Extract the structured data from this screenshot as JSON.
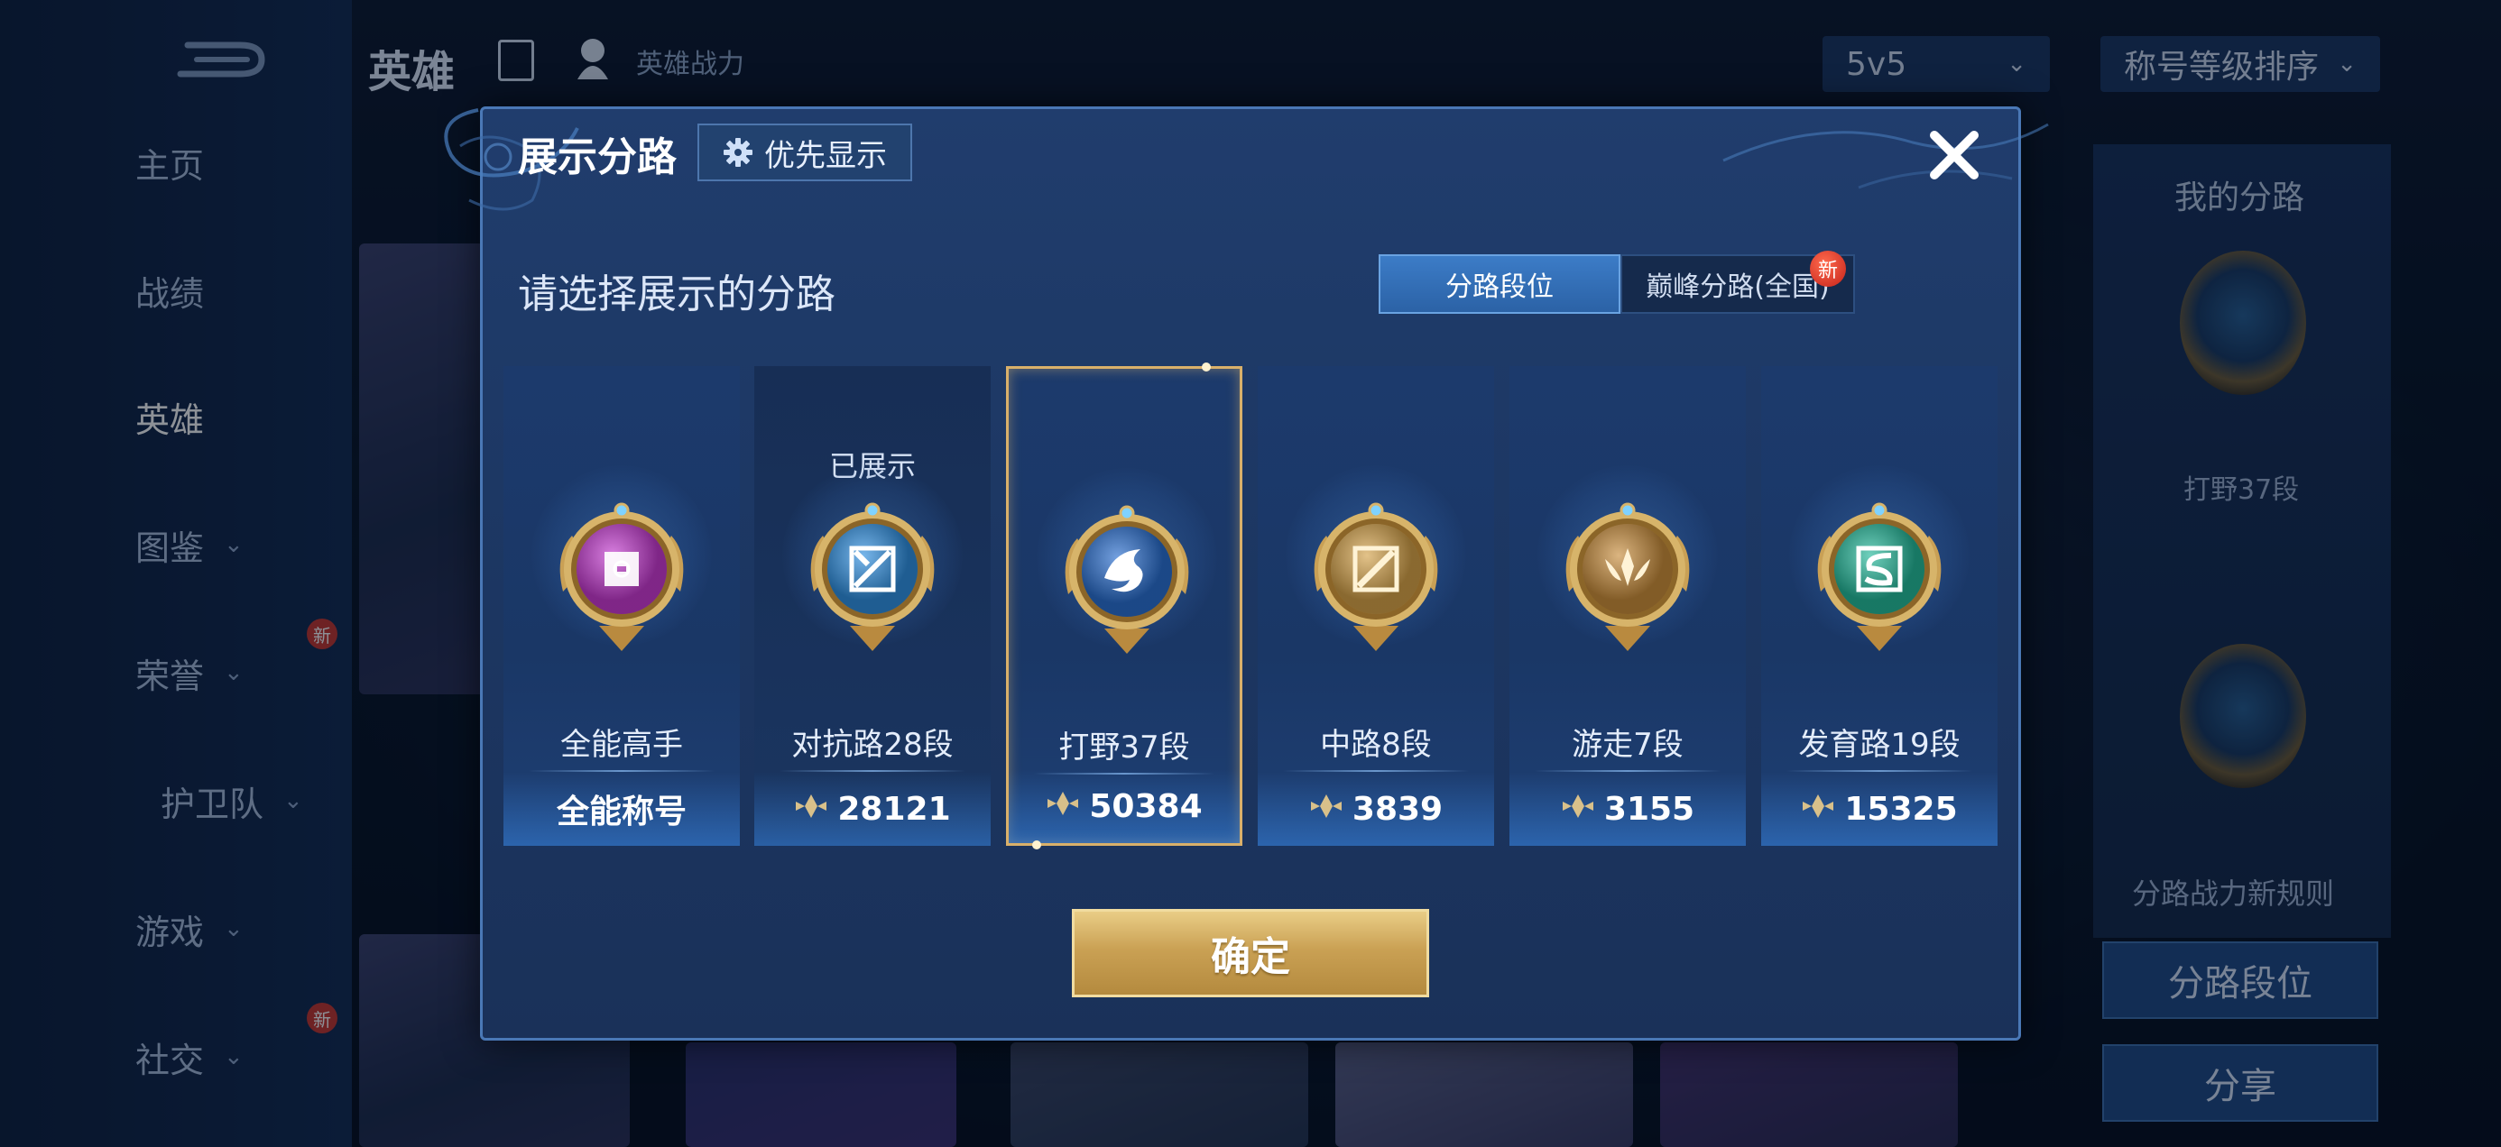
{
  "background": {
    "sidebar_items": [
      {
        "label": "主页",
        "chevron": false,
        "new": false,
        "active": false
      },
      {
        "label": "战绩",
        "chevron": false,
        "new": false,
        "active": false
      },
      {
        "label": "英雄",
        "chevron": false,
        "new": false,
        "active": true
      },
      {
        "label": "图鉴",
        "chevron": true,
        "new": false,
        "active": false
      },
      {
        "label": "荣誉",
        "chevron": true,
        "new": true,
        "active": false
      },
      {
        "label": "护卫队",
        "chevron": true,
        "new": false,
        "active": false
      },
      {
        "label": "游戏",
        "chevron": true,
        "new": false,
        "active": false
      },
      {
        "label": "社交",
        "chevron": true,
        "new": true,
        "active": false
      }
    ],
    "new_badge": "新",
    "header_title": "英雄",
    "header_power_label": "英雄战力",
    "mode_dropdown": "5v5",
    "sort_dropdown": "称号等级排序",
    "right_panel": {
      "title": "我的分路",
      "current_lane": "打野37段",
      "rules_link": "分路战力新规则",
      "lane_rank_button": "分路段位",
      "share_button": "分享"
    }
  },
  "dialog": {
    "title": "展示分路",
    "priority_button": "优先显示",
    "subtitle": "请选择展示的分路",
    "tabs": [
      {
        "label": "分路段位",
        "active": true,
        "new": false
      },
      {
        "label": "巅峰分路(全国)",
        "active": false,
        "new": true
      }
    ],
    "new_badge": "新",
    "cards": [
      {
        "name": "全能高手",
        "value": "全能称号",
        "show_value_icon": false,
        "status": "",
        "selected": false,
        "emblem": "allround-emblem-icon",
        "accent": "#c43bd0"
      },
      {
        "name": "对抗路28段",
        "value": "28121",
        "show_value_icon": true,
        "status": "已展示",
        "selected": false,
        "emblem": "clash-lane-emblem-icon",
        "accent": "#2f8fe0"
      },
      {
        "name": "打野37段",
        "value": "50384",
        "show_value_icon": true,
        "status": "",
        "selected": true,
        "emblem": "jungle-emblem-icon",
        "accent": "#2a6fd0"
      },
      {
        "name": "中路8段",
        "value": "3839",
        "show_value_icon": true,
        "status": "",
        "selected": false,
        "emblem": "mid-lane-emblem-icon",
        "accent": "#d4a24a"
      },
      {
        "name": "游走7段",
        "value": "3155",
        "show_value_icon": true,
        "status": "",
        "selected": false,
        "emblem": "roam-emblem-icon",
        "accent": "#c88d3c"
      },
      {
        "name": "发育路19段",
        "value": "15325",
        "show_value_icon": true,
        "status": "",
        "selected": false,
        "emblem": "farm-lane-emblem-icon",
        "accent": "#24b89a"
      }
    ],
    "confirm_button": "确定"
  }
}
